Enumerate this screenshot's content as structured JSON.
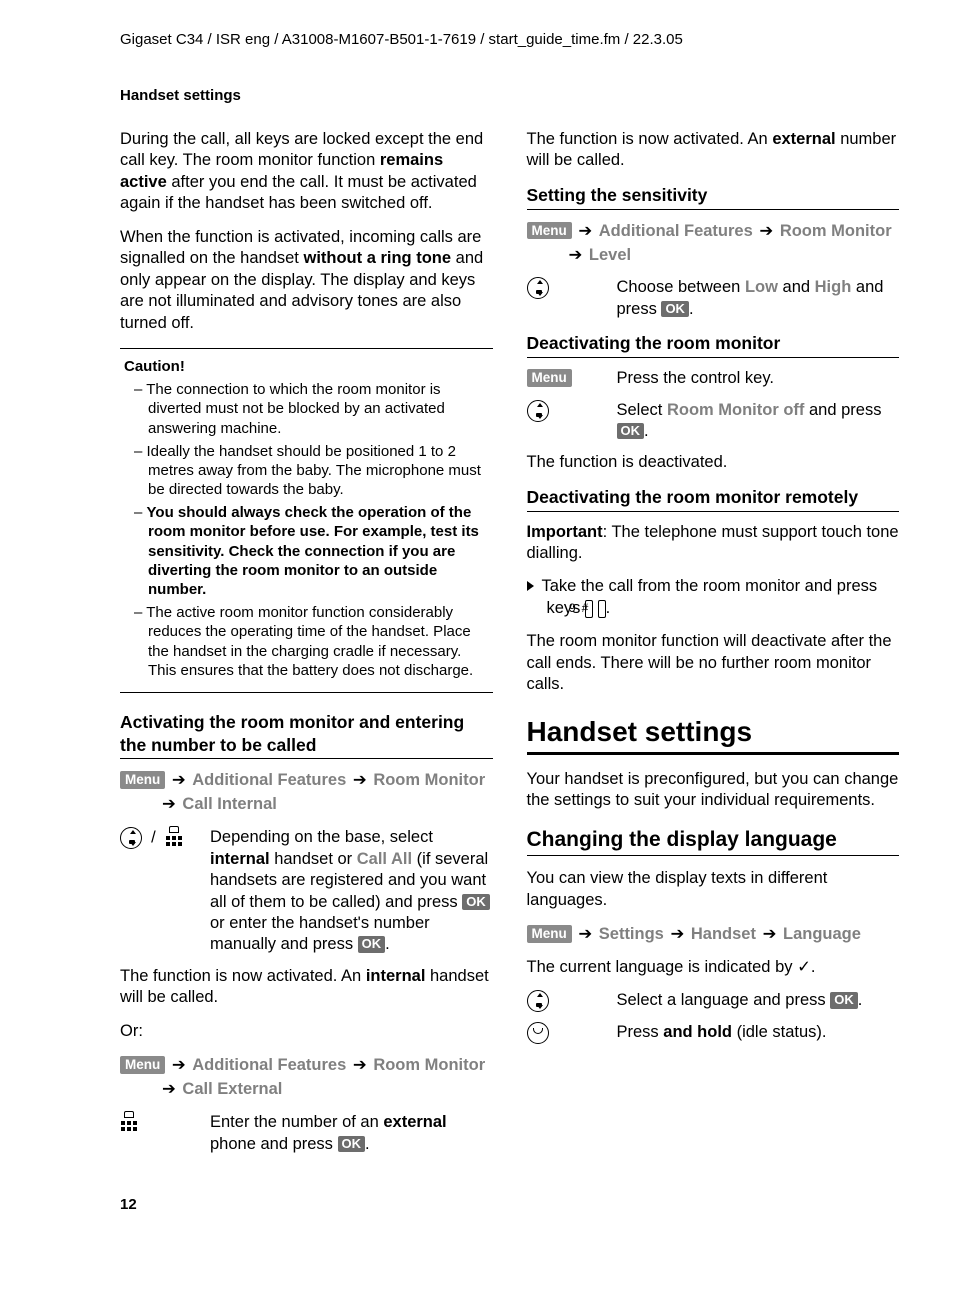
{
  "header": "Gigaset C34 / ISR eng / A31008-M1607-B501-1-7619 / start_guide_time.fm / 22.3.05",
  "running_head": "Handset settings",
  "left": {
    "p1a": "During the call, all keys are locked except the end call key. The room monitor function ",
    "p1b": "remains active",
    "p1c": " after you end the call. It must be activated again if the handset has been switched off.",
    "p2a": "When the function is activated, incoming calls are signalled on the handset ",
    "p2b": "without a ring tone",
    "p2c": " and only appear on the display. The display and keys are not illuminated and advisory tones are also turned off.",
    "caution_title": "Caution!",
    "caution": [
      "The connection to which the room monitor is diverted must not be blocked by an activated answering machine.",
      "Ideally the handset should be positioned 1 to 2 metres away from the baby. The microphone must be directed towards the baby.",
      "You should always check the operation of the room monitor before use. For example, test its sensitivity. Check the connection if you are diverting the room monitor to an outside number.",
      "The active room monitor function considerably reduces the operating time of the handset. Place the handset in the charging cradle if necessary. This ensures that the battery does not discharge."
    ],
    "h_activate": "Activating the room monitor and entering the number to be called",
    "path1": {
      "menu": "Menu",
      "a": "Additional Features",
      "b": "Room Monitor",
      "c": "Call Internal"
    },
    "step1a": "Depending on the base, select ",
    "step1b": "internal",
    "step1c": " handset or ",
    "step1d": "Call All",
    "step1e": " (if several handsets are registered and you want all of them to be called) and press ",
    "step1f": " or enter the handset's number manually and press ",
    "ok": "OK",
    "act_int_a": "The function is now activated. An ",
    "act_int_b": "internal",
    "act_int_c": " handset will be called.",
    "or": "Or:",
    "path2": {
      "menu": "Menu",
      "a": "Additional Features",
      "b": "Room Monitor",
      "c": "Call External"
    },
    "step2a": "Enter the number of an ",
    "step2b": "external",
    "step2c": " phone and press "
  },
  "right": {
    "act_ext_a": "The function is now activated. An ",
    "act_ext_b": "external",
    "act_ext_c": " number will be called.",
    "h_sens": "Setting the sensitivity",
    "path_sens": {
      "menu": "Menu",
      "a": "Additional Features",
      "b": "Room Monitor",
      "c": "Level"
    },
    "sens_a": "Choose between ",
    "sens_low": "Low",
    "sens_and": " and ",
    "sens_high": "High",
    "sens_b": " and press ",
    "h_deact": "Deactivating the room monitor",
    "deact_menu": "Menu",
    "deact_press": "Press the control key.",
    "deact_sel_a": "Select ",
    "deact_sel_b": "Room Monitor off",
    "deact_sel_c": " and press ",
    "deact_done": "The function is deactivated.",
    "h_remote": "Deactivating the room monitor remotely",
    "remote_a": "Important",
    "remote_b": ": The telephone must support touch tone dialling.",
    "remote_step": "Take the call from the room monitor and press keys ",
    "key9": "9",
    "keyhash": "#",
    "remote_after": "The room monitor function will deactivate after the call ends. There will be no further room monitor calls.",
    "h_handset": "Handset settings",
    "handset_intro": "Your handset is preconfigured, but you can change the settings to suit your individual requirements.",
    "h_lang": "Changing the display language",
    "lang_intro": "You can view the display texts in different languages.",
    "path_lang": {
      "menu": "Menu",
      "a": "Settings",
      "b": "Handset",
      "c": "Language"
    },
    "lang_ind": "The current language is indicated by ",
    "lang_sel": "Select a language and press ",
    "lang_hold_a": "Press ",
    "lang_hold_b": "and hold",
    "lang_hold_c": " (idle status)."
  },
  "ok": "OK",
  "pagenum": "12"
}
